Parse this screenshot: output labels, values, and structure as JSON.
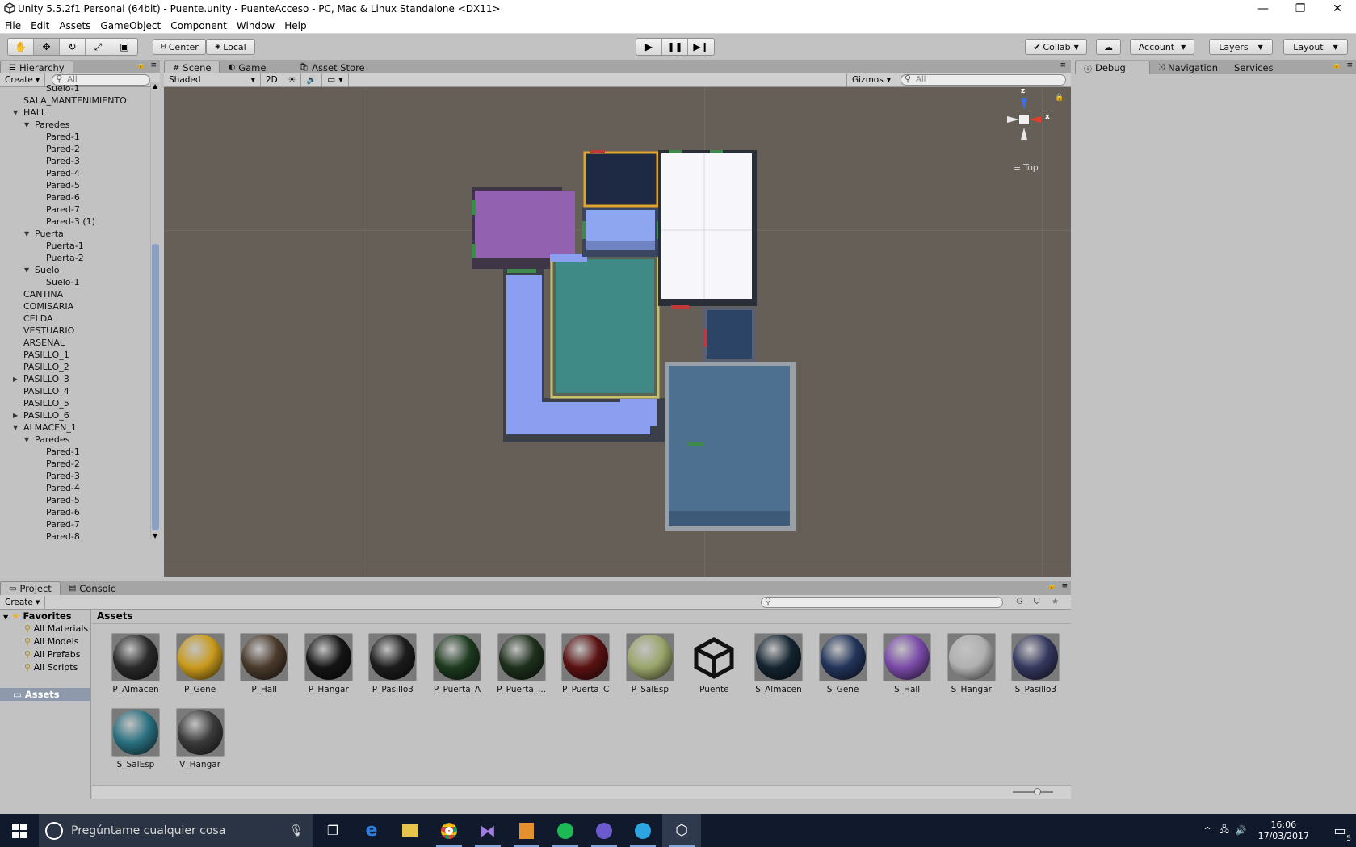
{
  "window": {
    "title": "Unity 5.5.2f1 Personal (64bit) - Puente.unity - PuenteAcceso - PC, Mac & Linux Standalone <DX11>",
    "controls": {
      "minimize": "—",
      "restore": "❐",
      "close": "✕"
    }
  },
  "menu": [
    "File",
    "Edit",
    "Assets",
    "GameObject",
    "Component",
    "Window",
    "Help"
  ],
  "toolbar": {
    "pivot": "Center",
    "space": "Local",
    "collab": "Collab",
    "account": "Account",
    "layers": "Layers",
    "layout": "Layout"
  },
  "hierarchy": {
    "tab": "Hierarchy",
    "create": "Create",
    "search_placeholder": "All",
    "items": [
      {
        "label": "Suelo-1",
        "depth": 3,
        "arrow": ""
      },
      {
        "label": "SALA_MANTENIMIENTO",
        "depth": 1,
        "arrow": ""
      },
      {
        "label": "HALL",
        "depth": 1,
        "arrow": "open"
      },
      {
        "label": "Paredes",
        "depth": 2,
        "arrow": "open"
      },
      {
        "label": "Pared-1",
        "depth": 3,
        "arrow": ""
      },
      {
        "label": "Pared-2",
        "depth": 3,
        "arrow": ""
      },
      {
        "label": "Pared-3",
        "depth": 3,
        "arrow": ""
      },
      {
        "label": "Pared-4",
        "depth": 3,
        "arrow": ""
      },
      {
        "label": "Pared-5",
        "depth": 3,
        "arrow": ""
      },
      {
        "label": "Pared-6",
        "depth": 3,
        "arrow": ""
      },
      {
        "label": "Pared-7",
        "depth": 3,
        "arrow": ""
      },
      {
        "label": "Pared-3 (1)",
        "depth": 3,
        "arrow": ""
      },
      {
        "label": "Puerta",
        "depth": 2,
        "arrow": "open"
      },
      {
        "label": "Puerta-1",
        "depth": 3,
        "arrow": ""
      },
      {
        "label": "Puerta-2",
        "depth": 3,
        "arrow": ""
      },
      {
        "label": "Suelo",
        "depth": 2,
        "arrow": "open"
      },
      {
        "label": "Suelo-1",
        "depth": 3,
        "arrow": ""
      },
      {
        "label": "CANTINA",
        "depth": 1,
        "arrow": ""
      },
      {
        "label": "COMISARIA",
        "depth": 1,
        "arrow": ""
      },
      {
        "label": "CELDA",
        "depth": 1,
        "arrow": ""
      },
      {
        "label": "VESTUARIO",
        "depth": 1,
        "arrow": ""
      },
      {
        "label": "ARSENAL",
        "depth": 1,
        "arrow": ""
      },
      {
        "label": "PASILLO_1",
        "depth": 1,
        "arrow": ""
      },
      {
        "label": "PASILLO_2",
        "depth": 1,
        "arrow": ""
      },
      {
        "label": "PASILLO_3",
        "depth": 1,
        "arrow": "closed"
      },
      {
        "label": "PASILLO_4",
        "depth": 1,
        "arrow": ""
      },
      {
        "label": "PASILLO_5",
        "depth": 1,
        "arrow": ""
      },
      {
        "label": "PASILLO_6",
        "depth": 1,
        "arrow": "closed"
      },
      {
        "label": "ALMACEN_1",
        "depth": 1,
        "arrow": "open"
      },
      {
        "label": "Paredes",
        "depth": 2,
        "arrow": "open"
      },
      {
        "label": "Pared-1",
        "depth": 3,
        "arrow": ""
      },
      {
        "label": "Pared-2",
        "depth": 3,
        "arrow": ""
      },
      {
        "label": "Pared-3",
        "depth": 3,
        "arrow": ""
      },
      {
        "label": "Pared-4",
        "depth": 3,
        "arrow": ""
      },
      {
        "label": "Pared-5",
        "depth": 3,
        "arrow": ""
      },
      {
        "label": "Pared-6",
        "depth": 3,
        "arrow": ""
      },
      {
        "label": "Pared-7",
        "depth": 3,
        "arrow": ""
      },
      {
        "label": "Pared-8",
        "depth": 3,
        "arrow": ""
      }
    ]
  },
  "scene": {
    "tabs": [
      "Scene",
      "Game",
      "Asset Store"
    ],
    "shading": "Shaded",
    "mode_2d": "2D",
    "gizmos": "Gizmos",
    "search_placeholder": "All",
    "gizmo_label": "Top",
    "axis_z": "z",
    "axis_x": "x"
  },
  "inspector": {
    "tabs": [
      "Debug",
      "Navigation",
      "Services"
    ]
  },
  "project": {
    "tabs": [
      "Project",
      "Console"
    ],
    "create": "Create",
    "favorites_label": "Favorites",
    "favorites": [
      "All Materials",
      "All Models",
      "All Prefabs",
      "All Scripts"
    ],
    "assets_folder": "Assets",
    "breadcrumb": "Assets",
    "assets": [
      {
        "name": "P_Almacen",
        "color": "#2a2a2a"
      },
      {
        "name": "P_Gene",
        "color": "#c89a1c"
      },
      {
        "name": "P_Hall",
        "color": "#4a3a2c"
      },
      {
        "name": "P_Hangar",
        "color": "#151515"
      },
      {
        "name": "P_Pasillo3",
        "color": "#1c1c1c"
      },
      {
        "name": "P_Puerta_A",
        "color": "#1d3a1f"
      },
      {
        "name": "P_Puerta_...",
        "color": "#1e301c"
      },
      {
        "name": "P_Puerta_C",
        "color": "#5a1212"
      },
      {
        "name": "P_SalEsp",
        "color": "#9aa56a"
      },
      {
        "name": "Puente",
        "color": "unity"
      },
      {
        "name": "S_Almacen",
        "color": "#142430"
      },
      {
        "name": "S_Gene",
        "color": "#22345a"
      },
      {
        "name": "S_Hall",
        "color": "#7a4aa8"
      },
      {
        "name": "S_Hangar",
        "color": "#b0b0b0"
      },
      {
        "name": "S_Pasillo3",
        "color": "#34385e"
      },
      {
        "name": "S_SalEsp",
        "color": "#2a7080"
      },
      {
        "name": "V_Hangar",
        "color": "#3a3a3a"
      }
    ]
  },
  "taskbar": {
    "search_placeholder": "Pregúntame cualquier cosa",
    "time": "16:06",
    "date": "17/03/2017",
    "notifications": "5"
  }
}
